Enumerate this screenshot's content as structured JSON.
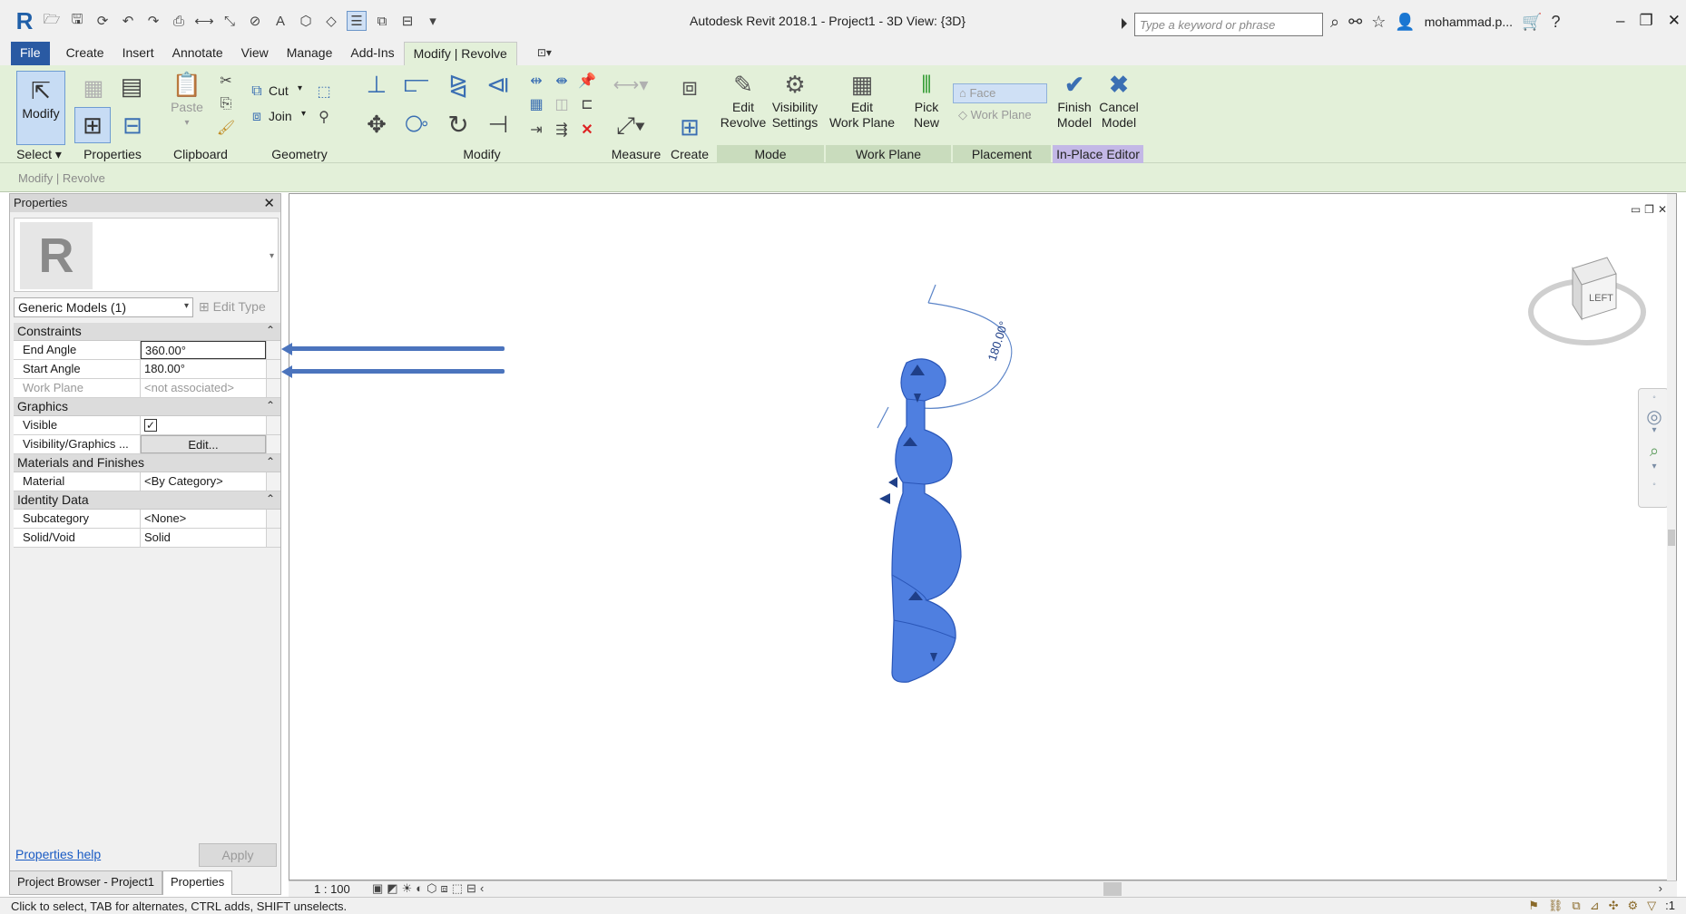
{
  "title_bar": {
    "app_title": "Autodesk Revit 2018.1 -     Project1 - 3D View: {3D}",
    "search_placeholder": "Type a keyword or phrase",
    "user": "mohammad.p...",
    "help_symbol": "?"
  },
  "tabs": [
    {
      "label": "File"
    },
    {
      "label": "Create"
    },
    {
      "label": "Insert"
    },
    {
      "label": "Annotate"
    },
    {
      "label": "View"
    },
    {
      "label": "Manage"
    },
    {
      "label": "Add-Ins"
    },
    {
      "label": "Modify | Revolve"
    }
  ],
  "ribbon": {
    "modify_label": "Modify",
    "paste_label": "Paste",
    "cut_label": "Cut",
    "join_label": "Join",
    "edit_revolve": [
      "Edit",
      "Revolve"
    ],
    "visibility_settings": [
      "Visibility",
      "Settings"
    ],
    "edit_work_plane": [
      "Edit",
      "Work Plane"
    ],
    "pick_new": [
      "Pick",
      "New"
    ],
    "face_label": "Face",
    "work_plane_label": "Work Plane",
    "finish_model": [
      "Finish",
      "Model"
    ],
    "cancel_model": [
      "Cancel",
      "Model"
    ],
    "panels": {
      "select": "Select ▾",
      "properties": "Properties",
      "clipboard": "Clipboard",
      "geometry": "Geometry",
      "modify": "Modify",
      "measure": "Measure",
      "create": "Create",
      "mode": "Mode",
      "work_plane": "Work Plane",
      "placement": "Placement",
      "in_place_editor": "In-Place Editor"
    }
  },
  "options_bar": {
    "text": "Modify | Revolve"
  },
  "properties": {
    "title": "Properties",
    "type_selector": "Generic Models (1)",
    "edit_type": "Edit Type",
    "categories": {
      "constraints": "Constraints",
      "graphics": "Graphics",
      "materials": "Materials and Finishes",
      "identity": "Identity Data"
    },
    "rows": {
      "end_angle": {
        "name": "End Angle",
        "value": "360.00°"
      },
      "start_angle": {
        "name": "Start Angle",
        "value": "180.00°"
      },
      "work_plane": {
        "name": "Work Plane",
        "value": "<not associated>"
      },
      "visible": {
        "name": "Visible",
        "value": "✓"
      },
      "visibility_graphics": {
        "name": "Visibility/Graphics ...",
        "value": "Edit..."
      },
      "material": {
        "name": "Material",
        "value": "<By Category>"
      },
      "subcategory": {
        "name": "Subcategory",
        "value": "<None>"
      },
      "solid_void": {
        "name": "Solid/Void",
        "value": "Solid"
      }
    },
    "help_link": "Properties help",
    "apply": "Apply"
  },
  "bottom_tabs": [
    {
      "label": "Project Browser - Project1"
    },
    {
      "label": "Properties"
    }
  ],
  "view": {
    "dimension_label": "180.00°",
    "viewcube_face": "LEFT",
    "scale": "1 : 100",
    "model_color": "#4f7fe0"
  },
  "status": {
    "text": "Click to select, TAB for alternates, CTRL adds, SHIFT unselects.",
    "filter_count": ":1"
  }
}
